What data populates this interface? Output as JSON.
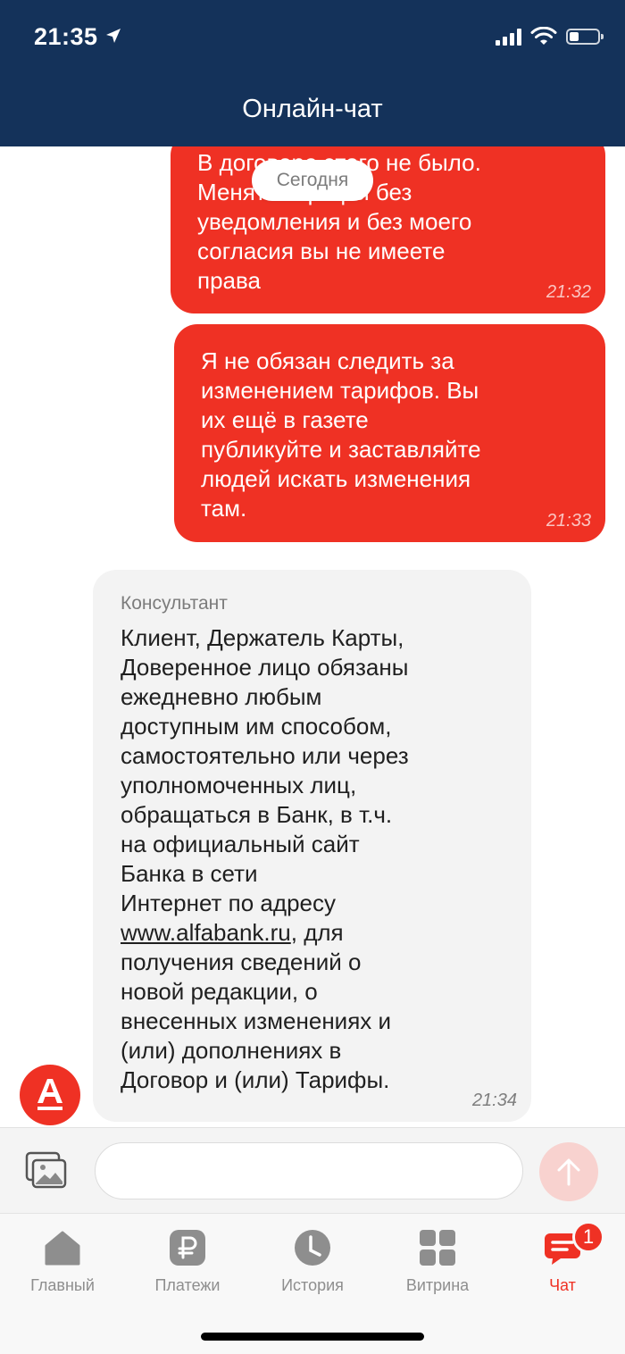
{
  "status_bar": {
    "time": "21:35"
  },
  "header": {
    "title": "Онлайн-чат"
  },
  "chat": {
    "date_label": "Сегодня",
    "messages": [
      {
        "direction": "out",
        "text": "В договоре этого не было.\nМенять тарифы без\nуведомления и без моего\nсогласия вы не имеете\nправа",
        "time": "21:32"
      },
      {
        "direction": "out",
        "text": "Я не обязан следить за\nизменением тарифов. Вы\nих ещё в газете\nпубликуйте и заставляйте\nлюдей искать изменения\nтам.",
        "time": "21:33"
      },
      {
        "direction": "in",
        "author": "Консультант",
        "text_before": "Клиент, Держатель Карты,\nДоверенное лицо обязаны\nежедневно любым\nдоступным им способом,\nсамостоятельно или через\nуполномоченных лиц,\nобращаться в Банк, в т.ч.\nна официальный сайт\nБанка в сети\nИнтернет по адресу\n",
        "link": "www.alfabank.ru",
        "text_after": ", для\nполучения сведений о\nновой редакции, о\nвнесенных изменениях и\n(или) дополнениях в\nДоговор и (или) Тарифы.",
        "time": "21:34"
      }
    ]
  },
  "composer": {
    "placeholder": "",
    "value": ""
  },
  "tabbar": {
    "items": [
      {
        "label": "Главный",
        "icon": "home-icon"
      },
      {
        "label": "Платежи",
        "icon": "ruble-icon"
      },
      {
        "label": "История",
        "icon": "clock-icon"
      },
      {
        "label": "Витрина",
        "icon": "grid-icon"
      },
      {
        "label": "Чат",
        "icon": "chat-icon",
        "badge": "1",
        "active": true
      }
    ]
  },
  "colors": {
    "header_bg": "#14325a",
    "accent": "#ef3124",
    "incoming_bg": "#f3f3f3"
  }
}
